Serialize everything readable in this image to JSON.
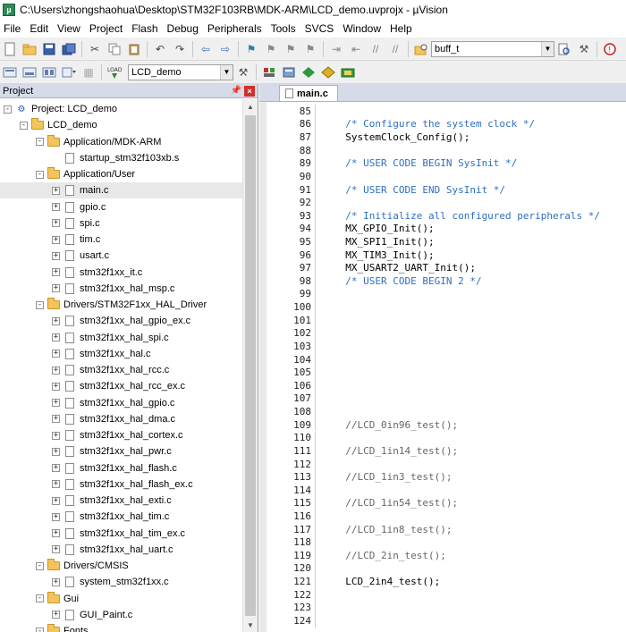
{
  "window": {
    "title": "C:\\Users\\zhongshaohua\\Desktop\\STM32F103RB\\MDK-ARM\\LCD_demo.uvprojx - µVision"
  },
  "menu": [
    "File",
    "Edit",
    "View",
    "Project",
    "Flash",
    "Debug",
    "Peripherals",
    "Tools",
    "SVCS",
    "Window",
    "Help"
  ],
  "toolbar": {
    "find_combo_value": "buff_t",
    "target_combo_value": "LCD_demo",
    "load_label": "LOAD"
  },
  "project_panel": {
    "title": "Project",
    "items": [
      {
        "label": "Project: LCD_demo",
        "depth": 0,
        "kind": "project",
        "expander": "-"
      },
      {
        "label": "LCD_demo",
        "depth": 1,
        "kind": "folder",
        "expander": "-"
      },
      {
        "label": "Application/MDK-ARM",
        "depth": 2,
        "kind": "folder",
        "expander": "-"
      },
      {
        "label": "startup_stm32f103xb.s",
        "depth": 3,
        "kind": "file",
        "expander": ""
      },
      {
        "label": "Application/User",
        "depth": 2,
        "kind": "folder",
        "expander": "-"
      },
      {
        "label": "main.c",
        "depth": 3,
        "kind": "file",
        "expander": "+",
        "selected": true
      },
      {
        "label": "gpio.c",
        "depth": 3,
        "kind": "file",
        "expander": "+"
      },
      {
        "label": "spi.c",
        "depth": 3,
        "kind": "file",
        "expander": "+"
      },
      {
        "label": "tim.c",
        "depth": 3,
        "kind": "file",
        "expander": "+"
      },
      {
        "label": "usart.c",
        "depth": 3,
        "kind": "file",
        "expander": "+"
      },
      {
        "label": "stm32f1xx_it.c",
        "depth": 3,
        "kind": "file",
        "expander": "+"
      },
      {
        "label": "stm32f1xx_hal_msp.c",
        "depth": 3,
        "kind": "file",
        "expander": "+"
      },
      {
        "label": "Drivers/STM32F1xx_HAL_Driver",
        "depth": 2,
        "kind": "folder",
        "expander": "-"
      },
      {
        "label": "stm32f1xx_hal_gpio_ex.c",
        "depth": 3,
        "kind": "file",
        "expander": "+"
      },
      {
        "label": "stm32f1xx_hal_spi.c",
        "depth": 3,
        "kind": "file",
        "expander": "+"
      },
      {
        "label": "stm32f1xx_hal.c",
        "depth": 3,
        "kind": "file",
        "expander": "+"
      },
      {
        "label": "stm32f1xx_hal_rcc.c",
        "depth": 3,
        "kind": "file",
        "expander": "+"
      },
      {
        "label": "stm32f1xx_hal_rcc_ex.c",
        "depth": 3,
        "kind": "file",
        "expander": "+"
      },
      {
        "label": "stm32f1xx_hal_gpio.c",
        "depth": 3,
        "kind": "file",
        "expander": "+"
      },
      {
        "label": "stm32f1xx_hal_dma.c",
        "depth": 3,
        "kind": "file",
        "expander": "+"
      },
      {
        "label": "stm32f1xx_hal_cortex.c",
        "depth": 3,
        "kind": "file",
        "expander": "+"
      },
      {
        "label": "stm32f1xx_hal_pwr.c",
        "depth": 3,
        "kind": "file",
        "expander": "+"
      },
      {
        "label": "stm32f1xx_hal_flash.c",
        "depth": 3,
        "kind": "file",
        "expander": "+"
      },
      {
        "label": "stm32f1xx_hal_flash_ex.c",
        "depth": 3,
        "kind": "file",
        "expander": "+"
      },
      {
        "label": "stm32f1xx_hal_exti.c",
        "depth": 3,
        "kind": "file",
        "expander": "+"
      },
      {
        "label": "stm32f1xx_hal_tim.c",
        "depth": 3,
        "kind": "file",
        "expander": "+"
      },
      {
        "label": "stm32f1xx_hal_tim_ex.c",
        "depth": 3,
        "kind": "file",
        "expander": "+"
      },
      {
        "label": "stm32f1xx_hal_uart.c",
        "depth": 3,
        "kind": "file",
        "expander": "+"
      },
      {
        "label": "Drivers/CMSIS",
        "depth": 2,
        "kind": "folder",
        "expander": "-"
      },
      {
        "label": "system_stm32f1xx.c",
        "depth": 3,
        "kind": "file",
        "expander": "+"
      },
      {
        "label": "Gui",
        "depth": 2,
        "kind": "folder",
        "expander": "-"
      },
      {
        "label": "GUI_Paint.c",
        "depth": 3,
        "kind": "file",
        "expander": "+"
      },
      {
        "label": "Fonts",
        "depth": 2,
        "kind": "folder",
        "expander": "-"
      }
    ]
  },
  "editor": {
    "active_tab": "main.c",
    "lines": [
      {
        "n": "85",
        "text": "",
        "style": "code"
      },
      {
        "n": "86",
        "text": "  /* Configure the system clock */",
        "style": "comment"
      },
      {
        "n": "87",
        "text": "  SystemClock_Config();",
        "style": "code"
      },
      {
        "n": "88",
        "text": "",
        "style": "code"
      },
      {
        "n": "89",
        "text": "  /* USER CODE BEGIN SysInit */",
        "style": "comment"
      },
      {
        "n": "90",
        "text": "",
        "style": "code"
      },
      {
        "n": "91",
        "text": "  /* USER CODE END SysInit */",
        "style": "comment"
      },
      {
        "n": "92",
        "text": "",
        "style": "code"
      },
      {
        "n": "93",
        "text": "  /* Initialize all configured peripherals */",
        "style": "comment"
      },
      {
        "n": "94",
        "text": "  MX_GPIO_Init();",
        "style": "code"
      },
      {
        "n": "95",
        "text": "  MX_SPI1_Init();",
        "style": "code"
      },
      {
        "n": "96",
        "text": "  MX_TIM3_Init();",
        "style": "code"
      },
      {
        "n": "97",
        "text": "  MX_USART2_UART_Init();",
        "style": "code"
      },
      {
        "n": "98",
        "text": "  /* USER CODE BEGIN 2 */",
        "style": "comment"
      },
      {
        "n": "99",
        "text": "",
        "style": "code"
      },
      {
        "n": "100",
        "text": "",
        "style": "code"
      },
      {
        "n": "101",
        "text": "",
        "style": "code"
      },
      {
        "n": "102",
        "text": "",
        "style": "code"
      },
      {
        "n": "103",
        "text": "",
        "style": "code"
      },
      {
        "n": "104",
        "text": "",
        "style": "code"
      },
      {
        "n": "105",
        "text": "",
        "style": "code"
      },
      {
        "n": "106",
        "text": "",
        "style": "code"
      },
      {
        "n": "107",
        "text": "",
        "style": "code"
      },
      {
        "n": "108",
        "text": "",
        "style": "code"
      },
      {
        "n": "109",
        "text": "  //LCD_0in96_test();",
        "style": "disabled"
      },
      {
        "n": "110",
        "text": "",
        "style": "code"
      },
      {
        "n": "111",
        "text": "  //LCD_1in14_test();",
        "style": "disabled"
      },
      {
        "n": "112",
        "text": "",
        "style": "code"
      },
      {
        "n": "113",
        "text": "  //LCD_1in3_test();",
        "style": "disabled"
      },
      {
        "n": "114",
        "text": "",
        "style": "code"
      },
      {
        "n": "115",
        "text": "  //LCD_1in54_test();",
        "style": "disabled"
      },
      {
        "n": "116",
        "text": "",
        "style": "code"
      },
      {
        "n": "117",
        "text": "  //LCD_1in8_test();",
        "style": "disabled"
      },
      {
        "n": "118",
        "text": "",
        "style": "code"
      },
      {
        "n": "119",
        "text": "  //LCD_2in_test();",
        "style": "disabled"
      },
      {
        "n": "120",
        "text": "",
        "style": "code"
      },
      {
        "n": "121",
        "text": "  LCD_2in4_test();",
        "style": "code"
      },
      {
        "n": "122",
        "text": "",
        "style": "code"
      },
      {
        "n": "123",
        "text": "",
        "style": "code"
      },
      {
        "n": "124",
        "text": "",
        "style": "code"
      }
    ]
  }
}
